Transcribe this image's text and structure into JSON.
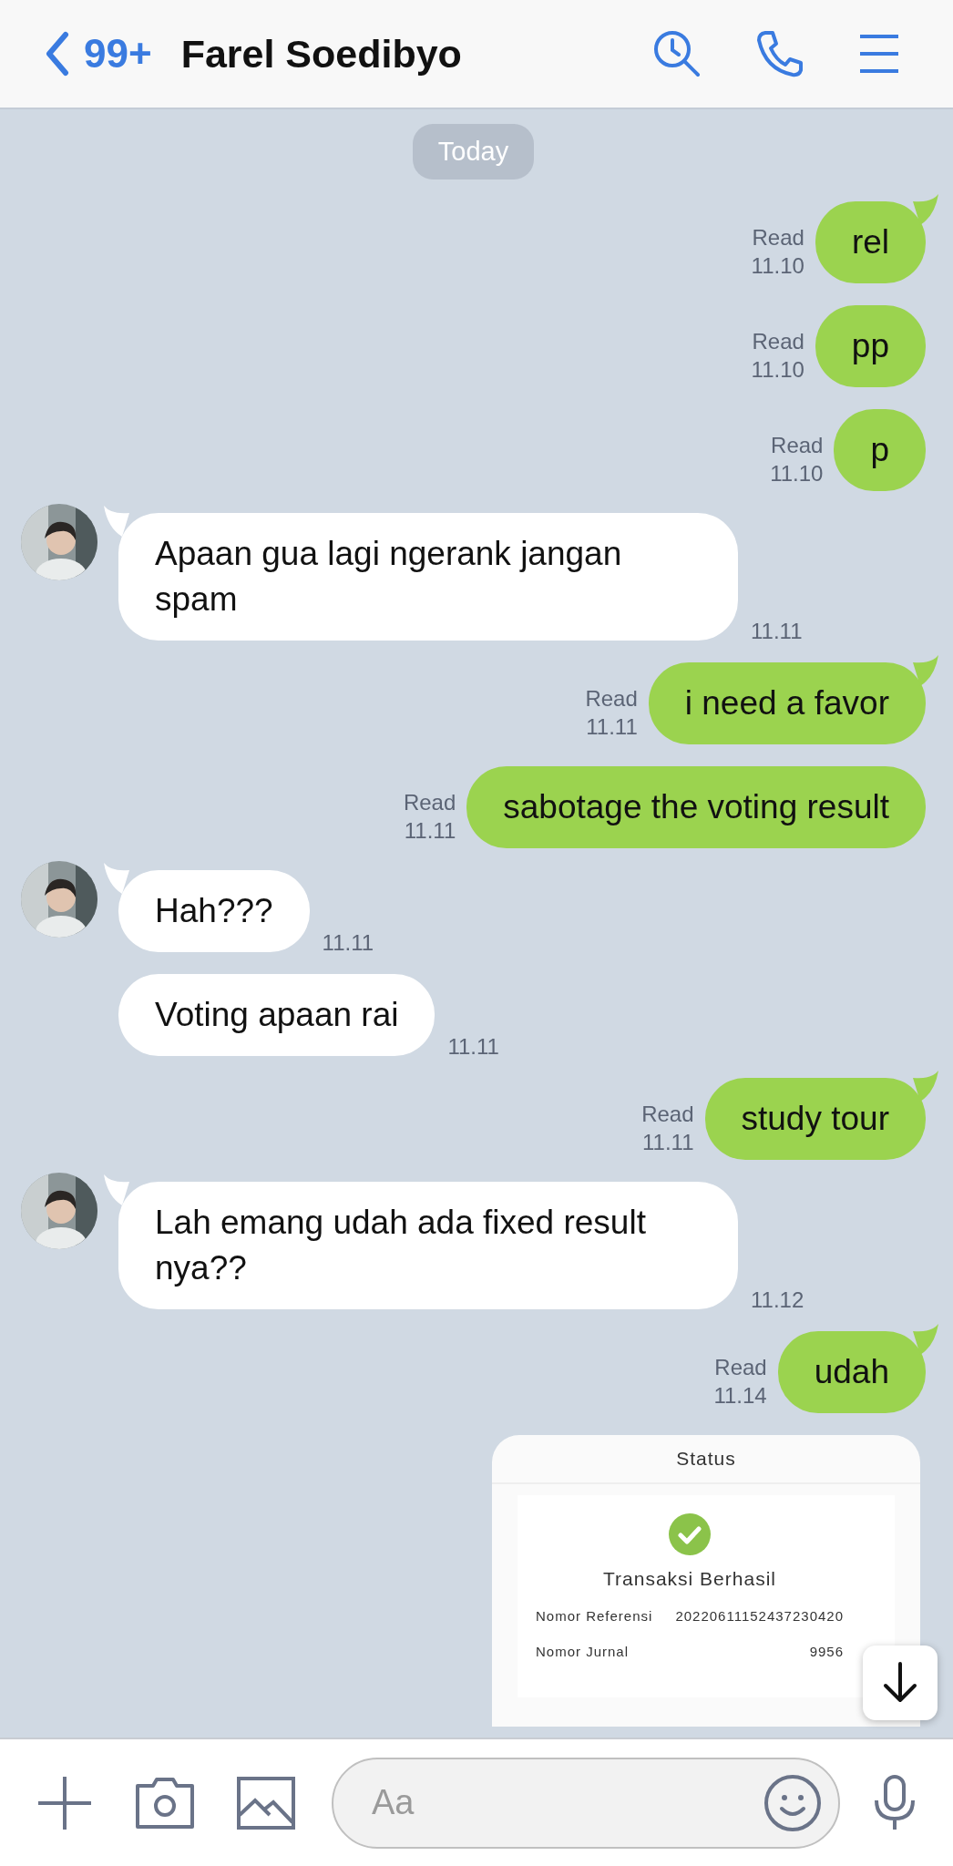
{
  "header": {
    "back_count": "99+",
    "title": "Farel Soedibyo"
  },
  "date_pill": "Today",
  "messages": [
    {
      "kind": "text",
      "outgoing": true,
      "tail": true,
      "text": "rel",
      "read": "Read",
      "time": "11.10"
    },
    {
      "kind": "text",
      "outgoing": true,
      "tail": false,
      "text": "pp",
      "read": "Read",
      "time": "11.10"
    },
    {
      "kind": "text",
      "outgoing": true,
      "tail": false,
      "text": "p",
      "read": "Read",
      "time": "11.10"
    },
    {
      "kind": "text",
      "outgoing": false,
      "tail": true,
      "text": "Apaan gua lagi ngerank jangan spam",
      "time": "11.11"
    },
    {
      "kind": "text",
      "outgoing": true,
      "tail": true,
      "text": "i need a favor",
      "read": "Read",
      "time": "11.11"
    },
    {
      "kind": "text",
      "outgoing": true,
      "tail": false,
      "text": "sabotage the voting result",
      "read": "Read",
      "time": "11.11"
    },
    {
      "kind": "text",
      "outgoing": false,
      "tail": true,
      "text": "Hah???",
      "time": "11.11"
    },
    {
      "kind": "text",
      "outgoing": false,
      "tail": false,
      "text": "Voting apaan rai",
      "time": "11.11"
    },
    {
      "kind": "text",
      "outgoing": true,
      "tail": true,
      "text": "study tour",
      "read": "Read",
      "time": "11.11"
    },
    {
      "kind": "text",
      "outgoing": false,
      "tail": true,
      "text": "Lah emang udah ada fixed result nya??",
      "time": "11.12"
    },
    {
      "kind": "text",
      "outgoing": true,
      "tail": true,
      "text": "udah",
      "read": "Read",
      "time": "11.14"
    },
    {
      "kind": "receipt",
      "header": "Status",
      "title": "Transaksi Berhasil",
      "rows": [
        {
          "label": "Nomor Referensi",
          "value": "20220611152437230420"
        },
        {
          "label": "Nomor Jurnal",
          "value": "9956"
        }
      ]
    }
  ],
  "composer": {
    "placeholder": "Aa"
  }
}
